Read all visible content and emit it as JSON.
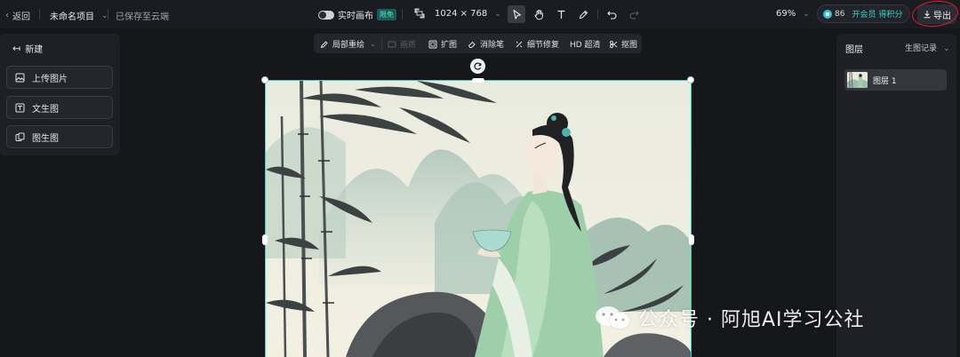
{
  "topbar": {
    "back_label": "返回",
    "project_name": "未命名项目",
    "save_status": "已保存至云端",
    "realtime_canvas_label": "实时画布",
    "free_badge": "限免",
    "canvas_size": "1024 × 768",
    "zoom": "69%",
    "credits": "86",
    "vip_label": "开会员 得积分",
    "export_label": "导出"
  },
  "left_panel": {
    "new_label": "新建",
    "buttons": [
      {
        "label": "上传图片",
        "icon": "image-upload-icon"
      },
      {
        "label": "文生图",
        "icon": "text-to-image-icon"
      },
      {
        "label": "图生图",
        "icon": "image-to-image-icon"
      }
    ]
  },
  "canvas_toolbar": {
    "items": [
      {
        "label": "局部重绘",
        "icon": "brush-icon",
        "enabled": true,
        "has_dropdown": true
      },
      {
        "label": "画质",
        "icon": "quality-icon",
        "enabled": false
      },
      {
        "label": "扩图",
        "icon": "expand-icon",
        "enabled": true
      },
      {
        "label": "消除笔",
        "icon": "eraser-icon",
        "enabled": true
      },
      {
        "label": "细节修复",
        "icon": "repair-icon",
        "enabled": true
      },
      {
        "label": "HD 超清",
        "icon": "hd-icon",
        "enabled": true
      },
      {
        "label": "抠图",
        "icon": "cutout-icon",
        "enabled": true
      }
    ]
  },
  "right_panel": {
    "title": "图层",
    "history_label": "生图记录",
    "layers": [
      {
        "name": "图层 1"
      }
    ]
  },
  "watermark": {
    "text": "公众号 · 阿旭AI学习公社"
  },
  "colors": {
    "background": "#16171b",
    "panel": "#1f2026",
    "accent": "#3fd1c6",
    "annotation_red": "#e11d2d"
  }
}
